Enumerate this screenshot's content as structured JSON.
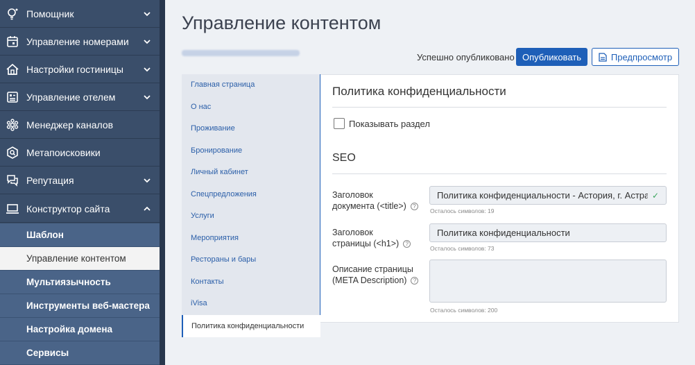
{
  "sidebar": {
    "items": [
      {
        "label": "Помощник",
        "icon": "lightbulb-icon",
        "chevron": "down"
      },
      {
        "label": "Управление номерами",
        "icon": "calendar-icon",
        "chevron": "down"
      },
      {
        "label": "Настройки гостиницы",
        "icon": "house-icon",
        "chevron": "down"
      },
      {
        "label": "Управление отелем",
        "icon": "dashboard-icon",
        "chevron": "down"
      },
      {
        "label": "Менеджер каналов",
        "icon": "channels-icon",
        "chevron": "none"
      },
      {
        "label": "Метапоисковики",
        "icon": "metasearch-icon",
        "chevron": "none"
      },
      {
        "label": "Репутация",
        "icon": "chat-icon",
        "chevron": "down"
      },
      {
        "label": "Конструктор сайта",
        "icon": "laptop-icon",
        "chevron": "up"
      }
    ],
    "sub_items": [
      {
        "label": "Шаблон",
        "active": false
      },
      {
        "label": "Управление контентом",
        "active": true
      },
      {
        "label": "Мультиязычность",
        "active": false
      },
      {
        "label": "Инструменты веб-мастера",
        "active": false
      },
      {
        "label": "Настройка домена",
        "active": false
      },
      {
        "label": "Сервисы",
        "active": false
      }
    ]
  },
  "header": {
    "title": "Управление контентом",
    "status": "Успешно опубликовано",
    "publish_label": "Опубликовать",
    "preview_label": "Предпросмотр"
  },
  "content_nav": {
    "items": [
      "Главная страница",
      "О нас",
      "Проживание",
      "Бронирование",
      "Личный кабинет",
      "Спецпредложения",
      "Услуги",
      "Мероприятия",
      "Рестораны и бары",
      "Контакты",
      "iVisa"
    ],
    "active": "Политика конфиденциальности"
  },
  "panel": {
    "title": "Политика конфиденциальности",
    "show_section_label": "Показывать раздел",
    "show_section_checked": false,
    "seo_title": "SEO",
    "fields": [
      {
        "label_line1": "Заголовок",
        "label_line2": "документа (<title>)",
        "value": "Политика конфиденциальности - Астория, г. Астрахань",
        "hint": "Осталось символов: 19",
        "valid": true
      },
      {
        "label_line1": "Заголовок",
        "label_line2": "страницы (<h1>)",
        "value": "Политика конфиденциальности",
        "hint": "Осталось символов: 73",
        "valid": false
      },
      {
        "label_line1": "Описание страницы",
        "label_line2": "(META Description)",
        "value": "",
        "hint": "Осталось символов: 200",
        "valid": false
      }
    ]
  },
  "colors": {
    "sidebar_bg": "#3a4e6a",
    "sub_bg": "#4a6488",
    "accent": "#1e5fb8",
    "valid": "#3aa55d"
  }
}
